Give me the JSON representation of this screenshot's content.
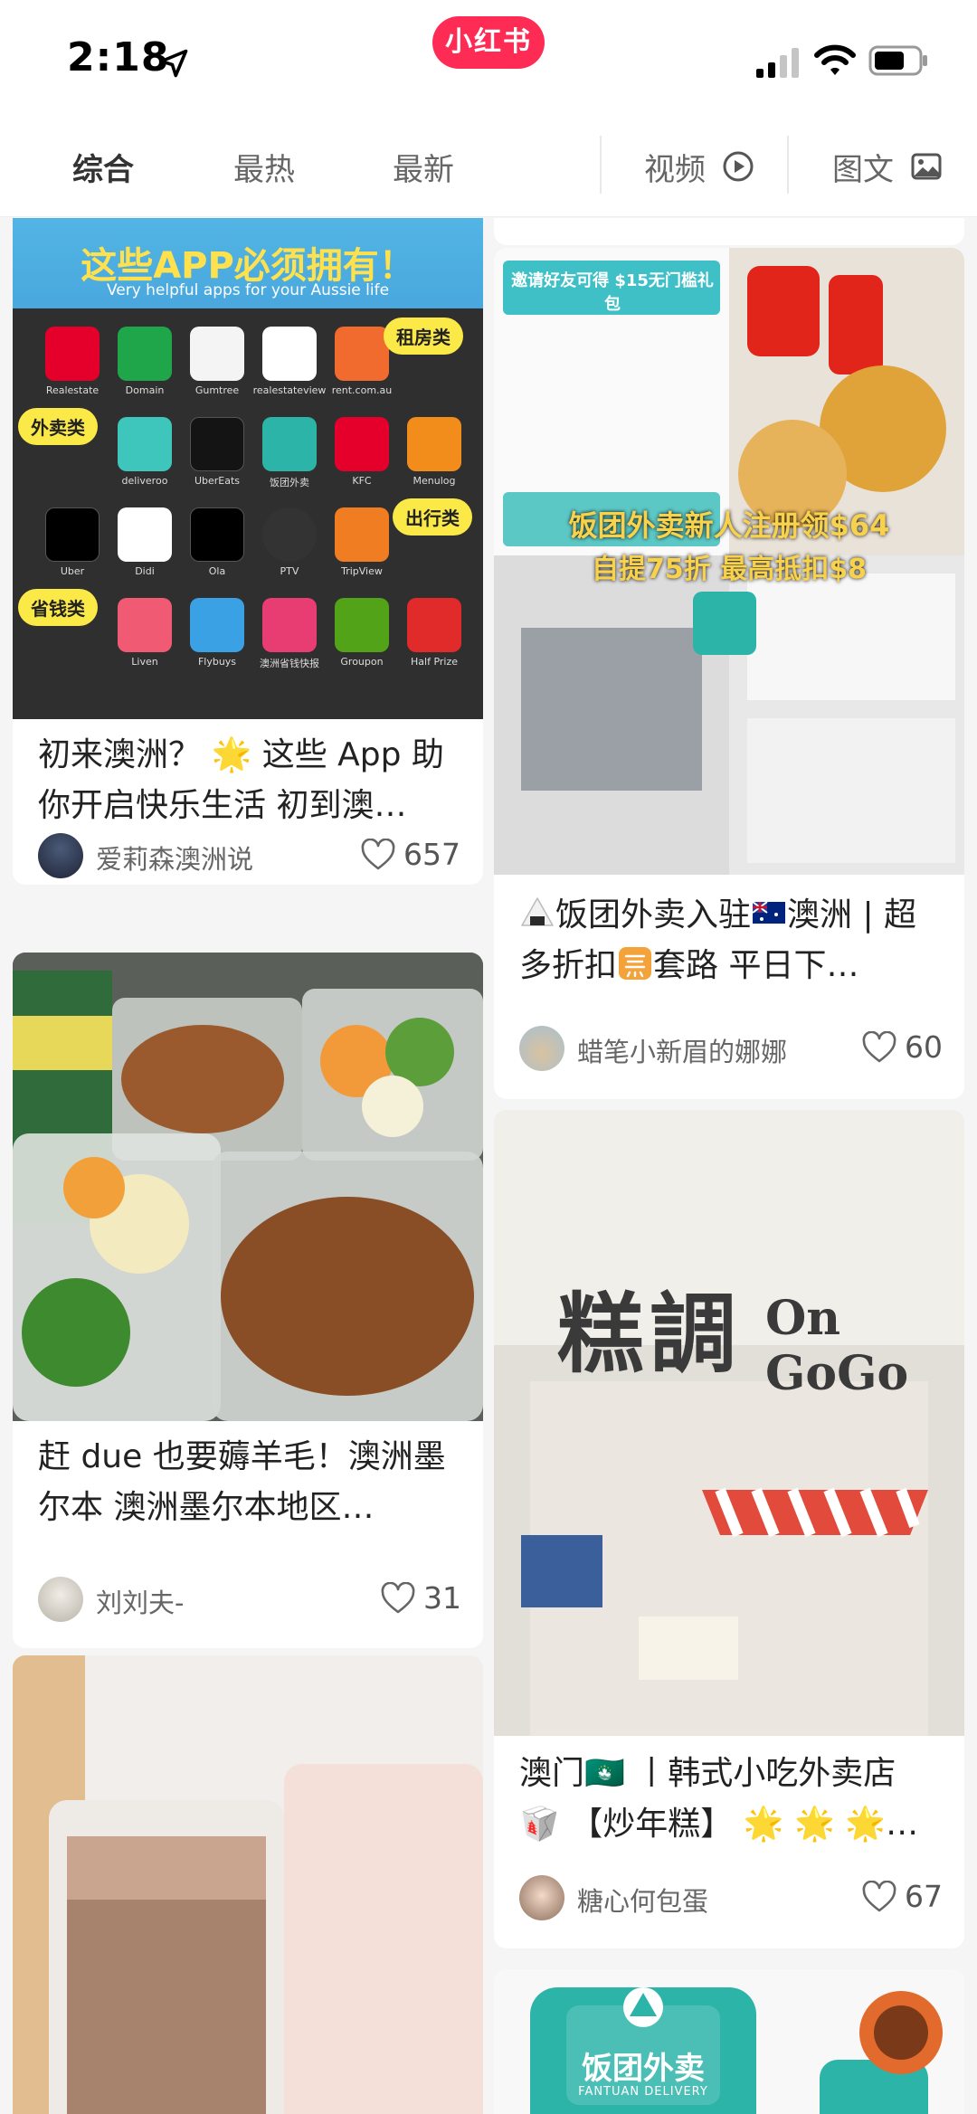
{
  "status_bar": {
    "time": "2:18",
    "brand": "小红书"
  },
  "tabs": {
    "items": [
      "综合",
      "最热",
      "最新"
    ],
    "video": "视频",
    "image_text": "图文",
    "active_index": 0
  },
  "cards": [
    {
      "image_text": {
        "headline": "这些APP必须拥有！",
        "subline": "Very helpful apps for your Aussie life",
        "tag_rent": "租房类",
        "tag_food": "外卖类",
        "tag_travel": "出行类",
        "tag_save": "省钱类",
        "apps": [
          "Realestate",
          "Domain",
          "Gumtree",
          "realestateview",
          "rent.com.au",
          "deliveroo",
          "UberEats",
          "饭团外卖",
          "KFC",
          "Menulog",
          "Uber",
          "Didi",
          "Ola",
          "PTV",
          "TripView",
          "Liven",
          "Flybuys",
          "澳洲省钱快报",
          "Groupon",
          "Half Prize"
        ]
      },
      "title": "初来澳洲？ 🌟 这些 App 助你开启快乐生活 初到澳…",
      "author": "爱莉森澳洲说",
      "likes": "657"
    },
    {
      "image_text": {
        "invite": "邀请好友可得 $15无门槛礼包",
        "headline1": "饭团外卖新人注册领$64",
        "headline2": "自提75折 最高抵扣$8"
      },
      "title_pre": "饭团外卖入驻",
      "title_mid": "澳洲 | 超多折扣",
      "title_post": "套路 平日下…",
      "author": "蜡笔小新眉的娜娜",
      "likes": "60"
    },
    {
      "title": "赶 due 也要薅羊毛！澳洲墨尔本 澳洲墨尔本地区…",
      "author": "刘刘夫-",
      "likes": "31"
    },
    {
      "image_text": {
        "sign_cn": "糕調",
        "sign_en": "On GoGo"
      },
      "title_line1": "澳门🇲🇴 丨韩式小吃外卖店",
      "title_line2": "🥡 【炒年糕】 🌟 🌟 🌟…",
      "author": "糖心何包蛋",
      "likes": "67"
    },
    {
      "image_text": {
        "bag_cn": "饭团外卖",
        "bag_en": "FANTUAN DELIVERY"
      }
    }
  ],
  "colors": {
    "brand": "#fe2c55",
    "background": "#f5f5f5",
    "card": "#ffffff"
  },
  "icons": [
    "location-arrow-icon",
    "cellular-signal-icon",
    "wifi-icon",
    "battery-icon",
    "play-circle-icon",
    "image-icon",
    "heart-icon"
  ]
}
